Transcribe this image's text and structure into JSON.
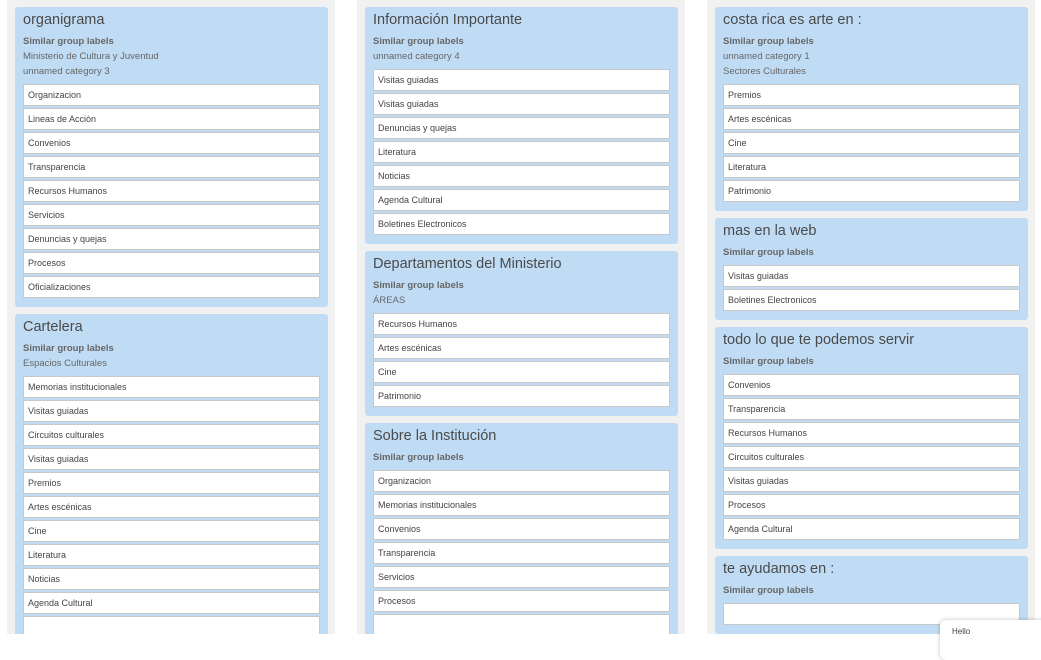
{
  "columns": [
    {
      "groups": [
        {
          "title": "organigrama",
          "similar_heading": "Similar group labels",
          "labels": [
            "Ministerio de Cultura y Juventud",
            "unnamed category 3"
          ],
          "items": [
            "Organizacion",
            "Lineas de Acciòn",
            "Convenios",
            "Transparencia",
            "Recursos Humanos",
            "Servicios",
            "Denuncias y quejas",
            "Procesos",
            "Oficializaciones"
          ]
        },
        {
          "title": "Cartelera",
          "similar_heading": "Similar group labels",
          "labels": [
            "Espacios Culturales"
          ],
          "items": [
            "Memorias institucionales",
            "Visitas guiadas",
            "Circuitos culturales",
            "Visitas guiadas",
            "Premios",
            "Artes escénicas",
            "Cine",
            "Literatura",
            "Noticias",
            "Agenda Cultural",
            ""
          ]
        }
      ]
    },
    {
      "groups": [
        {
          "title": "Información Importante",
          "similar_heading": "Similar group labels",
          "labels": [
            "unnamed category 4"
          ],
          "items": [
            "Visitas guiadas",
            "Visitas guiadas",
            "Denuncias y quejas",
            "Literatura",
            "Noticias",
            "Agenda Cultural",
            "Boletines Electronicos"
          ]
        },
        {
          "title": "Departamentos del Ministerio",
          "similar_heading": "Similar group labels",
          "labels": [
            "ÁREAS"
          ],
          "items": [
            "Recursos Humanos",
            "Artes escénicas",
            "Cine",
            "Patrimonio"
          ]
        },
        {
          "title": "Sobre la Institución",
          "similar_heading": "Similar group labels",
          "labels": [],
          "items": [
            "Organizacion",
            "Memorias institucionales",
            "Convenios",
            "Transparencia",
            "Servicios",
            "Procesos",
            ""
          ]
        }
      ]
    },
    {
      "groups": [
        {
          "title": "costa rica es arte en :",
          "similar_heading": "Similar group labels",
          "labels": [
            "unnamed category 1",
            "Sectores Culturales"
          ],
          "items": [
            "Premios",
            "Artes escénicas",
            "Cine",
            "Literatura",
            "Patrimonio"
          ]
        },
        {
          "title": "mas en la web",
          "similar_heading": "Similar group labels",
          "labels": [],
          "items": [
            "Visitas guiadas",
            "Boletines Electronicos"
          ]
        },
        {
          "title": "todo lo que te podemos servir",
          "similar_heading": "Similar group labels",
          "labels": [],
          "items": [
            "Convenios",
            "Transparencia",
            "Recursos Humanos",
            "Circuitos culturales",
            "Visitas guiadas",
            "Procesos",
            "Agenda Cultural"
          ]
        },
        {
          "title": "te ayudamos en :",
          "similar_heading": "Similar group labels",
          "labels": [],
          "items": [
            ""
          ]
        }
      ]
    }
  ],
  "popup": {
    "text": "Hello"
  }
}
